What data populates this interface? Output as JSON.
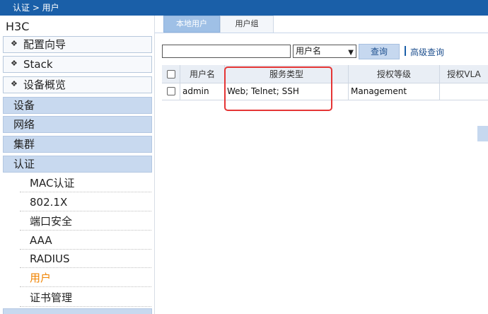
{
  "breadcrumb": "认证 > 用户",
  "sidebar": {
    "brand": "H3C",
    "top_items": [
      {
        "label": "配置向导"
      },
      {
        "label": "Stack"
      },
      {
        "label": "设备概览"
      }
    ],
    "sections": [
      {
        "label": "设备"
      },
      {
        "label": "网络"
      },
      {
        "label": "集群"
      },
      {
        "label": "认证"
      }
    ],
    "auth_items": [
      {
        "label": "MAC认证"
      },
      {
        "label": "802.1X"
      },
      {
        "label": "端口安全"
      },
      {
        "label": "AAA"
      },
      {
        "label": "RADIUS"
      },
      {
        "label": "用户"
      },
      {
        "label": "证书管理"
      }
    ]
  },
  "tabs": [
    {
      "label": "本地用户"
    },
    {
      "label": "用户组"
    }
  ],
  "search": {
    "value": "",
    "field_option": "用户名",
    "search_button": "查询",
    "advanced_link": "高级查询"
  },
  "table": {
    "columns": [
      "用户名",
      "服务类型",
      "授权等级",
      "授权VLA"
    ],
    "rows": [
      {
        "username": "admin",
        "service_type": "Web; Telnet; SSH",
        "auth_level": "Management",
        "auth_vlan": ""
      }
    ]
  },
  "colors": {
    "header_bar": "#1a5fa8",
    "active_menu": "#f08300",
    "highlight_box": "#e53535"
  }
}
